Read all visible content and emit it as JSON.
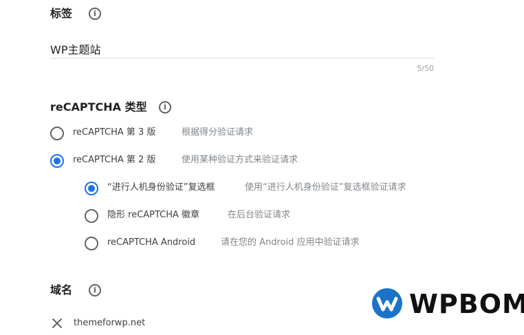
{
  "label_section": {
    "title": "标签",
    "info_icon": "info-icon",
    "input_value": "WP主题站",
    "counter": "5/50"
  },
  "recaptcha_section": {
    "title": "reCAPTCHA 类型",
    "info_icon": "info-icon",
    "options": [
      {
        "label": "reCAPTCHA 第 3 版",
        "desc": "根据得分验证请求",
        "selected": false
      },
      {
        "label": "reCAPTCHA 第 2 版",
        "desc": "使用某种验证方式来验证请求",
        "selected": true
      }
    ],
    "sub_options": [
      {
        "label": "“进行人机身份验证”复选框",
        "desc": "使用“进行人机身份验证”复选框验证请求",
        "selected": true
      },
      {
        "label": "隐形 reCAPTCHA 徽章",
        "desc": "在后台验证请求",
        "selected": false
      },
      {
        "label": "reCAPTCHA Android",
        "desc": "请在您的 Android 应用中验证请求",
        "selected": false
      }
    ]
  },
  "domain_section": {
    "title": "域名",
    "info_icon": "info-icon",
    "remove_icon": "close-icon",
    "domain": "themeforwp.net"
  },
  "watermark": {
    "text": "WPBOM",
    "logo_color": "#1a73c9"
  }
}
